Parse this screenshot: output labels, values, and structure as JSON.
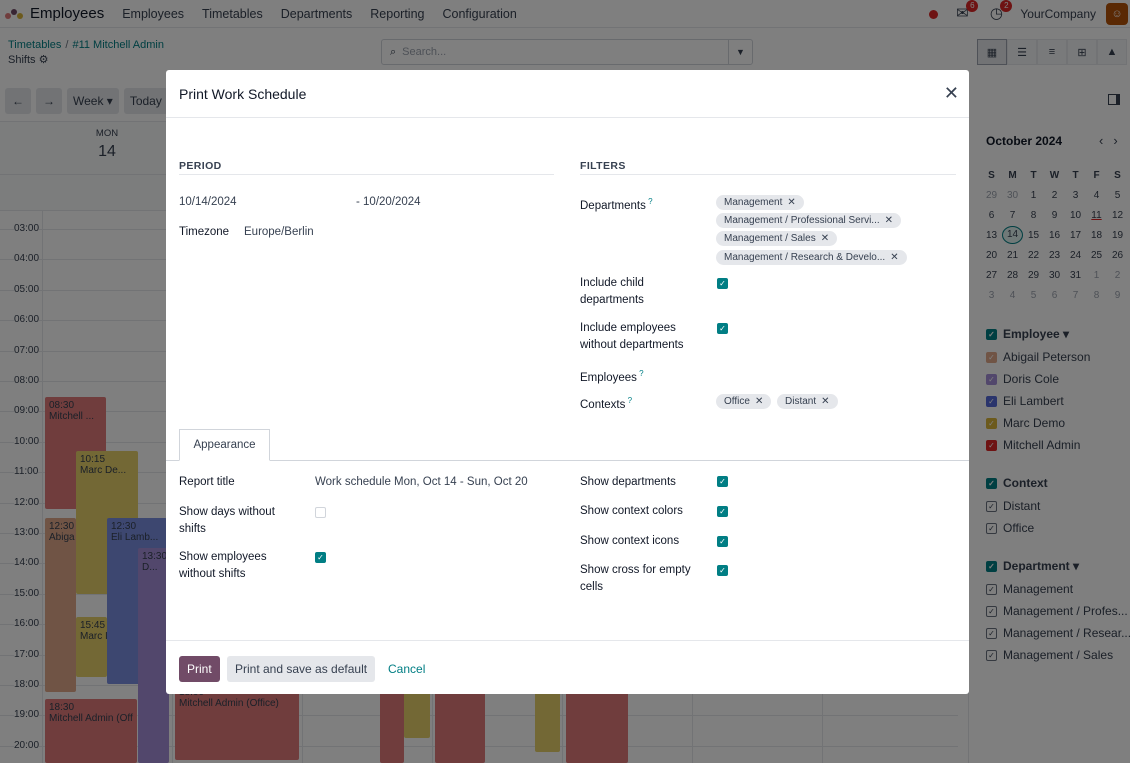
{
  "topbar": {
    "app_name": "Employees",
    "menu": [
      "Employees",
      "Timetables",
      "Departments",
      "Reporting",
      "Configuration"
    ],
    "chat_badge": "6",
    "activity_badge": "2",
    "company": "YourCompany"
  },
  "control": {
    "breadcrumb": [
      "Timetables",
      "#11 Mitchell Admin"
    ],
    "subtitle": "Shifts",
    "search_placeholder": "Search..."
  },
  "toolbar": {
    "week_label": "Week",
    "today_label": "Today"
  },
  "calendar": {
    "day_name": "MON",
    "day_number": "14",
    "hours": [
      "03:00",
      "04:00",
      "05:00",
      "06:00",
      "07:00",
      "08:00",
      "09:00",
      "10:00",
      "11:00",
      "12:00",
      "13:00",
      "14:00",
      "15:00",
      "16:00",
      "17:00",
      "18:00",
      "19:00",
      "20:00"
    ],
    "events": [
      {
        "time": "08:30",
        "title": "Mitchell ...",
        "color": "#e07b7b"
      },
      {
        "time": "10:15",
        "title": "Marc De...",
        "color": "#e6d06a"
      },
      {
        "time": "12:30",
        "title": "Abiga",
        "color": "#e0a98a"
      },
      {
        "time": "12:30",
        "title": "Eli Lamb...",
        "color": "#7b8fe0"
      },
      {
        "time": "13:30",
        "title": "D...",
        "color": "#a48fd8"
      },
      {
        "time": "15:45",
        "title": "Marc I",
        "color": "#e6d06a"
      },
      {
        "time": "18:30",
        "title": "Mitchell Admin (Off",
        "color": "#e07b7b"
      },
      {
        "time": "18:00",
        "title": "Mitchell Admin (Office)",
        "color": "#e07b7b"
      }
    ]
  },
  "sidebar": {
    "month_title": "October 2024",
    "weekdays": [
      "S",
      "M",
      "T",
      "W",
      "T",
      "F",
      "S"
    ],
    "weeks": [
      [
        "29",
        "30",
        "1",
        "2",
        "3",
        "4",
        "5"
      ],
      [
        "6",
        "7",
        "8",
        "9",
        "10",
        "11",
        "12"
      ],
      [
        "13",
        "14",
        "15",
        "16",
        "17",
        "18",
        "19"
      ],
      [
        "20",
        "21",
        "22",
        "23",
        "24",
        "25",
        "26"
      ],
      [
        "27",
        "28",
        "29",
        "30",
        "31",
        "1",
        "2"
      ],
      [
        "3",
        "4",
        "5",
        "6",
        "7",
        "8",
        "9"
      ]
    ],
    "employee_filter": {
      "title": "Employee",
      "items": [
        {
          "label": "Abigail Peterson",
          "color": "#e0a98a"
        },
        {
          "label": "Doris Cole",
          "color": "#a48fd8"
        },
        {
          "label": "Eli Lambert",
          "color": "#5468d8"
        },
        {
          "label": "Marc Demo",
          "color": "#d9b53a"
        },
        {
          "label": "Mitchell Admin",
          "color": "#dc2626"
        }
      ]
    },
    "context_filter": {
      "title": "Context",
      "items": [
        "Distant",
        "Office"
      ]
    },
    "department_filter": {
      "title": "Department",
      "items": [
        "Management",
        "Management / Profes...",
        "Management / Resear...",
        "Management / Sales"
      ]
    }
  },
  "modal": {
    "title": "Print Work Schedule",
    "period": {
      "heading": "PERIOD",
      "start": "10/14/2024",
      "end": "- 10/20/2024",
      "timezone_label": "Timezone",
      "timezone_value": "Europe/Berlin"
    },
    "filters": {
      "heading": "FILTERS",
      "departments_label": "Departments",
      "departments": [
        "Management",
        "Management / Professional Servi...",
        "Management / Sales",
        "Management / Research & Develo..."
      ],
      "include_child_label": "Include child departments",
      "include_without_dept_label": "Include employees without departments",
      "employees_label": "Employees",
      "contexts_label": "Contexts",
      "contexts": [
        "Office",
        "Distant"
      ]
    },
    "tab_label": "Appearance",
    "appearance": {
      "report_title_label": "Report title",
      "report_title_value": "Work schedule Mon, Oct 14 - Sun, Oct 20",
      "show_days_label": "Show days without shifts",
      "show_employees_label": "Show employees without shifts",
      "show_departments_label": "Show departments",
      "show_context_colors_label": "Show context colors",
      "show_context_icons_label": "Show context icons",
      "show_cross_label": "Show cross for empty cells"
    },
    "buttons": {
      "print": "Print",
      "print_default": "Print and save as default",
      "cancel": "Cancel"
    }
  }
}
